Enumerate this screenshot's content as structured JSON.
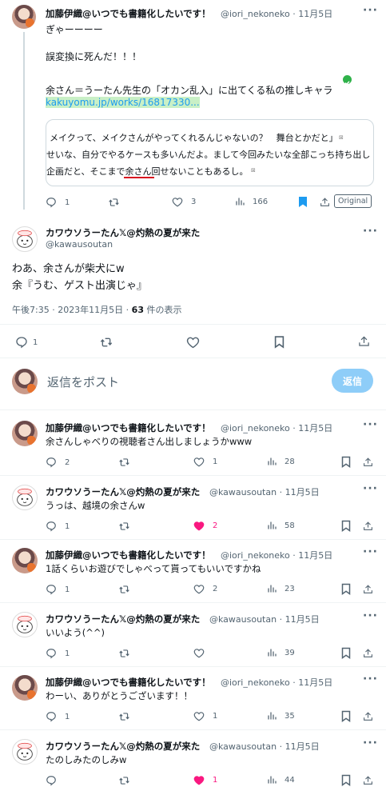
{
  "colors": {
    "accent": "#1d9bf0",
    "like": "#f91880",
    "muted": "#536471",
    "reply_button": "#8ecdf8"
  },
  "parent": {
    "author": "加藤伊織@いつでも書籍化したいです！",
    "handle": "@iori_nekoneko",
    "date": "11月5日",
    "lines": [
      "ぎゃーーーー",
      "誤変換に死んだ！！！",
      "余さん＝うーたん先生の「オカン乱入」に出てくる私の推しキャラ"
    ],
    "link": "kakuyomu.jp/works/16817330...",
    "quote_lines": [
      "メイクって、メイクさんがやってくれるんじゃないの？　舞台とかだと」",
      "せいな、自分でやるケースも多いんだよ。まして今回みたいな全部こっち持ち出し",
      "企画だと、そこまで余さん回せないこともあるし。"
    ],
    "stats": {
      "replies": "1",
      "reposts": "",
      "likes": "3",
      "views": "166"
    },
    "original_label": "Original"
  },
  "main": {
    "author": "カワウソうーたん𝕏@灼熱の夏が来た",
    "handle": "@kawausoutan",
    "lines": [
      "わあ、余さんが柴犬にw",
      "余『うむ、ゲスト出演じゃ』"
    ],
    "timestamp": "午後7:35 · 2023年11月5日 · ",
    "views_count": "63",
    "views_suffix": " 件の表示",
    "stats": {
      "replies": "1"
    }
  },
  "composer": {
    "placeholder": "返信をポスト",
    "button": "返信"
  },
  "replies": [
    {
      "author": "加藤伊織@いつでも書籍化したいです！",
      "handle": "@iori_nekoneko",
      "date": "11月5日",
      "text": "余さんしゃべりの視聴者さん出しましょうかwww",
      "replies": "2",
      "reposts": "",
      "likes": "1",
      "views": "28",
      "liked": false
    },
    {
      "author": "カワウソうーたん𝕏@灼熱の夏が来た",
      "handle": "@kawausoutan",
      "date": "11月5日",
      "text": "うっは、越境の余さんw",
      "replies": "1",
      "reposts": "",
      "likes": "2",
      "views": "58",
      "liked": true
    },
    {
      "author": "加藤伊織@いつでも書籍化したいです！",
      "handle": "@iori_nekoneko",
      "date": "11月5日",
      "text": "1話くらいお遊びでしゃべって貰ってもいいですかね",
      "replies": "1",
      "reposts": "",
      "likes": "2",
      "views": "23",
      "liked": false
    },
    {
      "author": "カワウソうーたん𝕏@灼熱の夏が来た",
      "handle": "@kawausoutan",
      "date": "11月5日",
      "text": "いいよう(^^)",
      "replies": "1",
      "reposts": "",
      "likes": "",
      "views": "39",
      "liked": false
    },
    {
      "author": "加藤伊織@いつでも書籍化したいです！",
      "handle": "@iori_nekoneko",
      "date": "11月5日",
      "text": "わーい、ありがとうございます！！",
      "replies": "1",
      "reposts": "",
      "likes": "1",
      "views": "35",
      "liked": false
    },
    {
      "author": "カワウソうーたん𝕏@灼熱の夏が来た",
      "handle": "@kawausoutan",
      "date": "11月5日",
      "text": "たのしみたのしみw",
      "replies": "",
      "reposts": "",
      "likes": "1",
      "views": "44",
      "liked": true
    }
  ]
}
